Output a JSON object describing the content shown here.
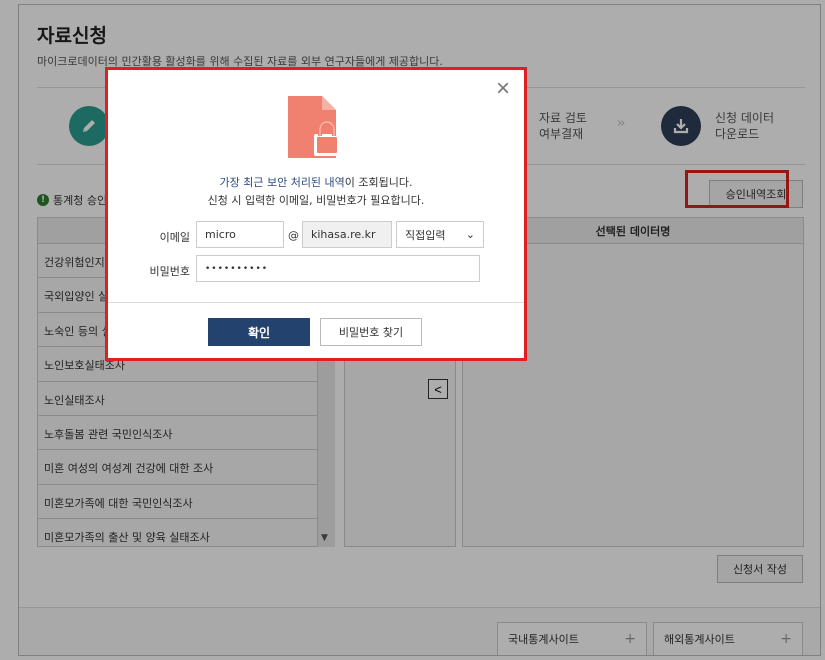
{
  "page": {
    "title": "자료신청",
    "description": "마이크로데이터의 민간활용 활성화를 위해 수집된 자료를 외부 연구자들에게 제공합니다."
  },
  "steps": {
    "review_line1": "자료 검토",
    "review_line2": "여부결재",
    "download_line1": "신청 데이터",
    "download_line2": "다운로드",
    "arrow": "››"
  },
  "notice": {
    "icon": "!",
    "text": "통계청 승인"
  },
  "approval_button": "승인내역조회",
  "survey_list": [
    {
      "label": "건강위험인지",
      "icon": ""
    },
    {
      "label": "국외입양인 실",
      "icon": ""
    },
    {
      "label": "노숙인 등의 실",
      "icon": ""
    },
    {
      "label": "노인보호실태조사",
      "icon": "filled"
    },
    {
      "label": "노인실태조사",
      "icon": "filled"
    },
    {
      "label": "노후돌봄 관련 국민인식조사",
      "icon": "outline"
    },
    {
      "label": "미혼 여성의 여성계 건강에 대한 조사",
      "icon": "outline"
    },
    {
      "label": "미혼모가족에 대한 국민인식조사",
      "icon": "outline"
    },
    {
      "label": "미혼모가족의 출산 및 양육 실태조사",
      "icon": "outline"
    }
  ],
  "selected_panel_header": "선택된 데이터명",
  "move_left_glyph": "<",
  "form_button": "신청서 작성",
  "footer": {
    "domestic": "국내통계사이트",
    "overseas": "해외통계사이트",
    "plus": "+"
  },
  "modal": {
    "close_glyph": "×",
    "msg_highlight": "가장 최근 보안 처리된 내역",
    "msg_rest": "이 조회됩니다.",
    "msg2": "신청 시 입력한 이메일, 비밀번호가 필요합니다.",
    "email_label": "이메일",
    "email_user": "micro",
    "at": "@",
    "email_domain": "kihasa.re.kr",
    "domain_select": "직접입력",
    "password_label": "비밀번호",
    "password_value": "••••••••••",
    "confirm_button": "확인",
    "find_password_button": "비밀번호 찾기"
  },
  "colors": {
    "accent_red": "#e02020",
    "confirm_navy": "#24426e",
    "lock_icon": "#f08070",
    "info_green": "#2e7d32"
  }
}
